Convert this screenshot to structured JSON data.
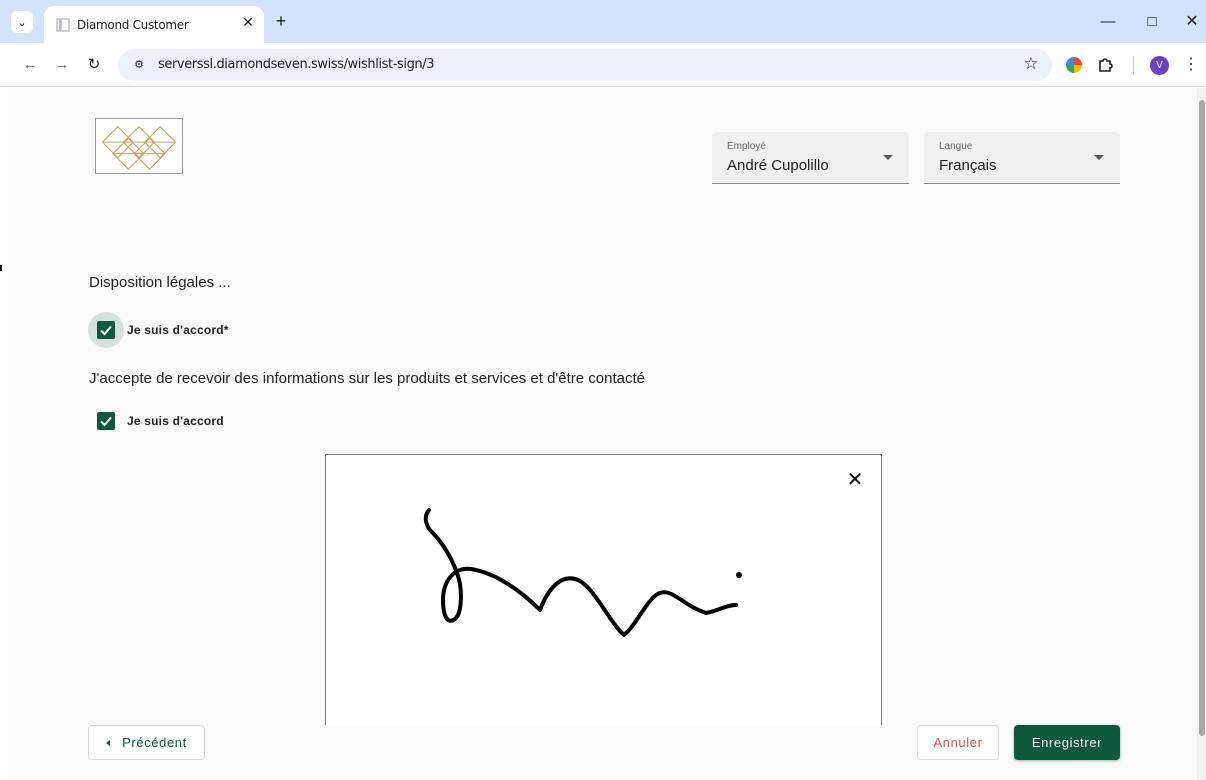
{
  "browser": {
    "tab_title": "Diamond Customer",
    "url": "serverssl.diamondseven.swiss/wishlist-sign/3",
    "avatar_initial": "V"
  },
  "header": {
    "employee": {
      "label": "Employé",
      "value": "André Cupolillo"
    },
    "language": {
      "label": "Langue",
      "value": "Français"
    }
  },
  "legal": {
    "title": "Disposition légales ...",
    "agree_required_label": "Je suis d'accord*",
    "agree_required_checked": true,
    "marketing_text": "J'accepte de recevoir des informations sur les produits et services et d'être contacté",
    "agree_marketing_label": "Je suis d'accord",
    "agree_marketing_checked": true
  },
  "footer": {
    "previous_label": "Précédent",
    "cancel_label": "Annuler",
    "save_label": "Enregistrer"
  },
  "colors": {
    "primary": "#0c5a3b",
    "danger": "#d9534f",
    "logo_gold": "#c9a25e",
    "tabstrip": "#d3e3fd"
  }
}
